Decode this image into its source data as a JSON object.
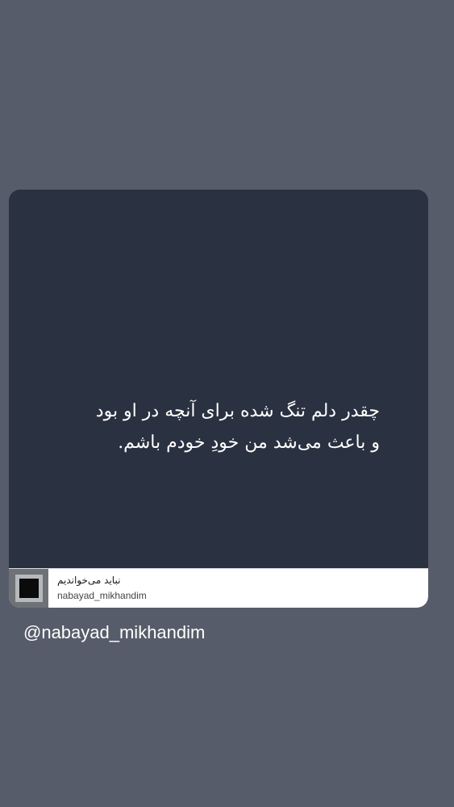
{
  "post": {
    "quote_line1": "چقدر دلم تنگ شده برای آنچه در او بود",
    "quote_line2": "و باعث می‌شد من خودِ خودم باشم."
  },
  "footer": {
    "display_name": "نباید می‌خواندیم",
    "username": "nabayad_mikhandim"
  },
  "story": {
    "handle": "@nabayad_mikhandim"
  },
  "colors": {
    "background": "#565c69",
    "card": "#2a3140",
    "text": "#ffffff"
  }
}
